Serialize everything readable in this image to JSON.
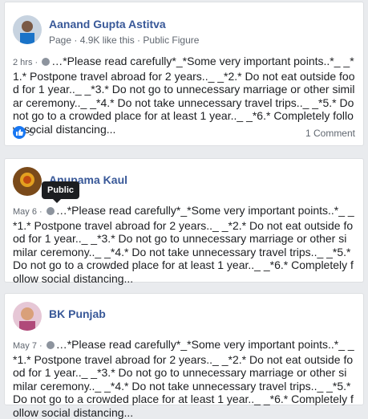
{
  "posts": [
    {
      "name": "Aanand Gupta Astitva",
      "subline": "Page · 4.9K like this · Public Figure",
      "time": "2 hrs · ",
      "text": "…*Please read carefully*_*Some very important points..*_ _*1.* Postpone travel abroad for 2 years.._ _*2.* Do not eat outside food for 1 year.._ _*3.* Do not go to unnecessary marriage or other similar ceremony.._ _*4.* Do not take unnecessary travel trips.._ _*5.* Do not go to a crowded place for at least 1 year.._ _*6.* Completely follow social distancing...",
      "likes": "5",
      "comments": "1 Comment"
    },
    {
      "name": "Anupama Kaul",
      "time": "May 6 · ",
      "tooltip": "Public",
      "text": "…*Please read carefully*_*Some very important points..*_ _*1.* Postpone travel abroad for 2 years.._ _*2.* Do not eat outside food for 1 year.._ _*3.* Do not go to unnecessary marriage or other similar ceremony.._ _*4.* Do not take unnecessary travel trips.._ _*5.* Do not go to a crowded place for at least 1 year.._ _*6.* Completely follow social distancing..."
    },
    {
      "name": "BK Punjab",
      "time": "May 7 · ",
      "text": "…*Please read carefully*_*Some very important points..*_ _*1.* Postpone travel abroad for 2 years.._ _*2.* Do not eat outside food for 1 year.._ _*3.* Do not go to unnecessary marriage or other similar ceremony.._ _*4.* Do not take unnecessary travel trips.._ _*5.* Do not go to a crowded place for at least 1 year.._ _*6.* Completely follow social distancing..."
    }
  ],
  "colors": {
    "link": "#385898",
    "like": "#1877f2",
    "background": "#e9ebee"
  }
}
